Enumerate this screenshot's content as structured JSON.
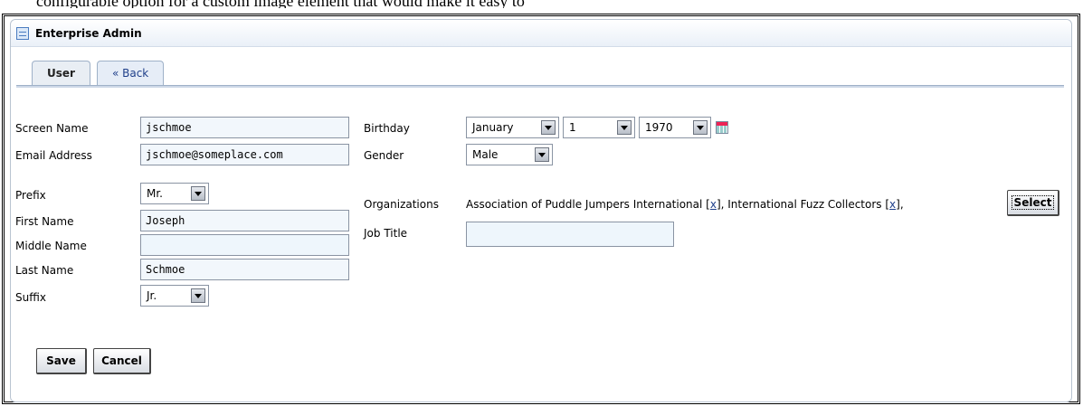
{
  "page": {
    "top_caption": "configurable option for a custom image element that would make it easy to"
  },
  "portlet": {
    "title": "Enterprise Admin",
    "icon": "window-list-icon"
  },
  "tabs": [
    {
      "label": "User"
    },
    {
      "label": "« Back"
    }
  ],
  "form": {
    "screen_name": {
      "label": "Screen Name",
      "value": "jschmoe"
    },
    "email": {
      "label": "Email Address",
      "value": "jschmoe@someplace.com"
    },
    "prefix": {
      "label": "Prefix",
      "value": "Mr."
    },
    "first_name": {
      "label": "First Name",
      "value": "Joseph"
    },
    "middle_name": {
      "label": "Middle Name",
      "value": ""
    },
    "last_name": {
      "label": "Last Name",
      "value": "Schmoe"
    },
    "suffix": {
      "label": "Suffix",
      "value": "Jr."
    },
    "birthday": {
      "label": "Birthday",
      "month": "January",
      "day": "1",
      "year": "1970",
      "icon": "calendar-icon"
    },
    "gender": {
      "label": "Gender",
      "value": "Male"
    },
    "organizations": {
      "label": "Organizations",
      "items": [
        {
          "name": "Association of Puddle Jumpers International",
          "remove": "x"
        },
        {
          "name": "International Fuzz Collectors",
          "remove": "x"
        }
      ],
      "select_label": "Select"
    },
    "job_title": {
      "label": "Job Title",
      "value": ""
    }
  },
  "buttons": {
    "save": "Save",
    "cancel": "Cancel"
  }
}
